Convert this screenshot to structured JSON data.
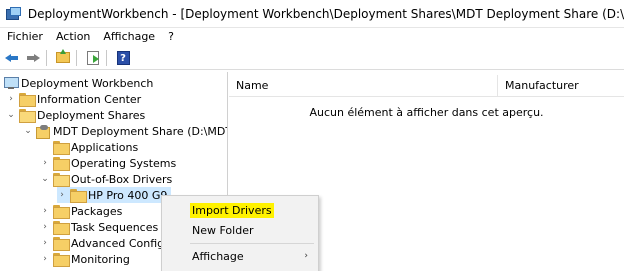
{
  "window": {
    "title": "DeploymentWorkbench - [Deployment Workbench\\Deployment Shares\\MDT Deployment Share (D:\\MDT)\\Out-of-Box Drivers\\"
  },
  "menubar": {
    "items": [
      "Fichier",
      "Action",
      "Affichage",
      "?"
    ]
  },
  "toolbar": {
    "buttons": [
      "back-icon",
      "forward-icon",
      "up-folder-icon",
      "export-icon",
      "help-icon"
    ]
  },
  "tree": {
    "items": [
      {
        "label": "Deployment Workbench",
        "level": 0,
        "expander": "none",
        "icon": "computer-icon"
      },
      {
        "label": "Information Center",
        "level": 1,
        "expander": "collapsed",
        "icon": "folder-icon"
      },
      {
        "label": "Deployment Shares",
        "level": 1,
        "expander": "expanded",
        "icon": "folder-icon"
      },
      {
        "label": "MDT Deployment Share (D:\\MDT)",
        "level": 2,
        "expander": "expanded",
        "icon": "deployment-share-icon"
      },
      {
        "label": "Applications",
        "level": 3,
        "expander": "none",
        "icon": "folder-icon"
      },
      {
        "label": "Operating Systems",
        "level": 3,
        "expander": "collapsed",
        "icon": "folder-icon"
      },
      {
        "label": "Out-of-Box Drivers",
        "level": 3,
        "expander": "expanded",
        "icon": "folder-icon"
      },
      {
        "label": "HP Pro 400 G9",
        "level": 4,
        "expander": "collapsed",
        "icon": "folder-icon",
        "selected": true
      },
      {
        "label": "Packages",
        "level": 3,
        "expander": "collapsed",
        "icon": "folder-icon"
      },
      {
        "label": "Task Sequences",
        "level": 3,
        "expander": "collapsed",
        "icon": "folder-icon"
      },
      {
        "label": "Advanced Configu",
        "level": 3,
        "expander": "collapsed",
        "icon": "folder-icon"
      },
      {
        "label": "Monitoring",
        "level": 3,
        "expander": "collapsed",
        "icon": "folder-icon"
      }
    ]
  },
  "list": {
    "columns": [
      "Name",
      "Manufacturer"
    ],
    "empty_message": "Aucun élément à afficher dans cet aperçu."
  },
  "context_menu": {
    "items": [
      {
        "label": "Import Drivers",
        "highlighted": true
      },
      {
        "label": "New Folder"
      },
      {
        "label": "Affichage",
        "submenu": true
      }
    ]
  },
  "colors": {
    "selection": "#cde8ff",
    "highlight": "#fff200"
  }
}
